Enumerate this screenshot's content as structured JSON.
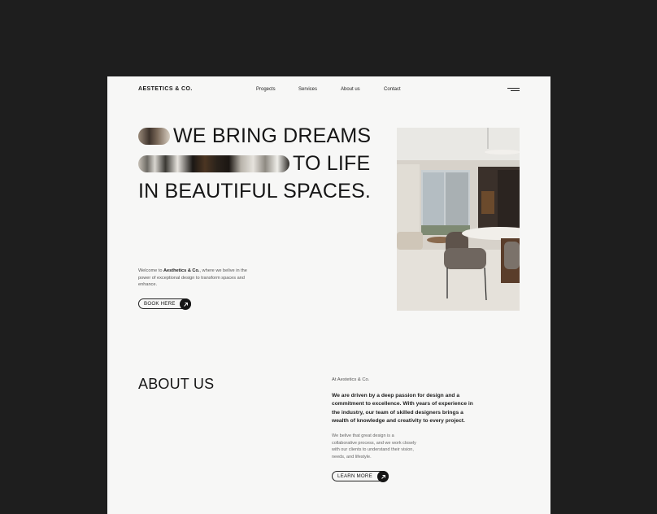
{
  "header": {
    "brand": "AESTETICS & CO.",
    "nav": [
      "Progects",
      "Services",
      "About us",
      "Contact"
    ],
    "menu_icon": "hamburger-menu-icon"
  },
  "hero": {
    "line1": "WE BRING DREAMS",
    "line2": "TO LIFE",
    "line3": "IN BEAUTIFUL SPACES.",
    "intro_prefix": "Welcome to ",
    "intro_bold": "Aesthetics & Co.",
    "intro_rest": ", where we belive in the power of exceptional design to transform spaces and enhance.",
    "cta_label": "BOOK HERE",
    "cta_icon": "arrow-up-right-icon"
  },
  "about": {
    "title": "ABOUT US",
    "company": "At Aestetics & Co.",
    "lead": "We are driven by a deep passion for design and a commitment to excellence. With years of experience in the industry, our team of skilled designers brings a wealth of knowledge and creativity to every project.",
    "body": "We belive that great design is a collaborative process, and we work closely with our clients to understand their vision, needs, and lifestyle.",
    "cta_label": "LEARN MORE",
    "cta_icon": "arrow-up-right-icon"
  },
  "colors": {
    "backdrop": "#1e1e1e",
    "page": "#f7f7f6",
    "ink": "#161616"
  }
}
